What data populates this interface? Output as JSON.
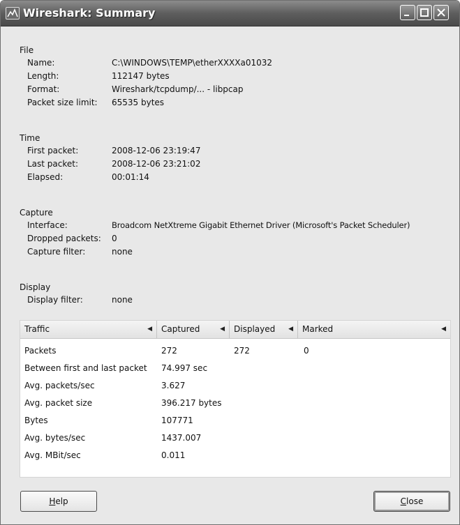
{
  "window": {
    "title": "Wireshark: Summary",
    "buttons": [
      "minimize",
      "maximize",
      "close"
    ]
  },
  "file": {
    "heading": "File",
    "rows": [
      {
        "key": "Name:",
        "value": "C:\\WINDOWS\\TEMP\\etherXXXXa01032"
      },
      {
        "key": "Length:",
        "value": "112147 bytes"
      },
      {
        "key": "Format:",
        "value": "Wireshark/tcpdump/... - libpcap"
      },
      {
        "key": "Packet size limit:",
        "value": "65535 bytes"
      }
    ]
  },
  "time": {
    "heading": "Time",
    "rows": [
      {
        "key": "First packet:",
        "value": "2008-12-06 23:19:47"
      },
      {
        "key": "Last packet:",
        "value": "2008-12-06 23:21:02"
      },
      {
        "key": "Elapsed:",
        "value": "00:01:14"
      }
    ]
  },
  "capture": {
    "heading": "Capture",
    "rows": [
      {
        "key": "Interface:",
        "value": "Broadcom NetXtreme Gigabit Ethernet Driver (Microsoft's Packet Scheduler)"
      },
      {
        "key": "Dropped packets:",
        "value": "0"
      },
      {
        "key": "Capture filter:",
        "value": "none"
      }
    ]
  },
  "display": {
    "heading": "Display",
    "rows": [
      {
        "key": "Display filter:",
        "value": "none"
      }
    ]
  },
  "traffic": {
    "columns": {
      "traffic": "Traffic",
      "captured": "Captured",
      "displayed": "Displayed",
      "marked": "Marked"
    },
    "rows": [
      {
        "name": "Packets",
        "captured": "272",
        "displayed": "272",
        "marked": "0"
      },
      {
        "name": "Between first and last packet",
        "captured": "74.997 sec",
        "displayed": "",
        "marked": ""
      },
      {
        "name": "Avg. packets/sec",
        "captured": "3.627",
        "displayed": "",
        "marked": ""
      },
      {
        "name": "Avg. packet size",
        "captured": "396.217 bytes",
        "displayed": "",
        "marked": ""
      },
      {
        "name": "Bytes",
        "captured": "107771",
        "displayed": "",
        "marked": ""
      },
      {
        "name": "Avg. bytes/sec",
        "captured": "1437.007",
        "displayed": "",
        "marked": ""
      },
      {
        "name": "Avg. MBit/sec",
        "captured": "0.011",
        "displayed": "",
        "marked": ""
      }
    ]
  },
  "footer": {
    "help_mnemonic": "H",
    "help_rest": "elp",
    "close_mnemonic": "C",
    "close_rest": "lose"
  },
  "colors": {
    "titlebar": "#5e5e5e",
    "dialog_bg": "#e8e8e8"
  }
}
